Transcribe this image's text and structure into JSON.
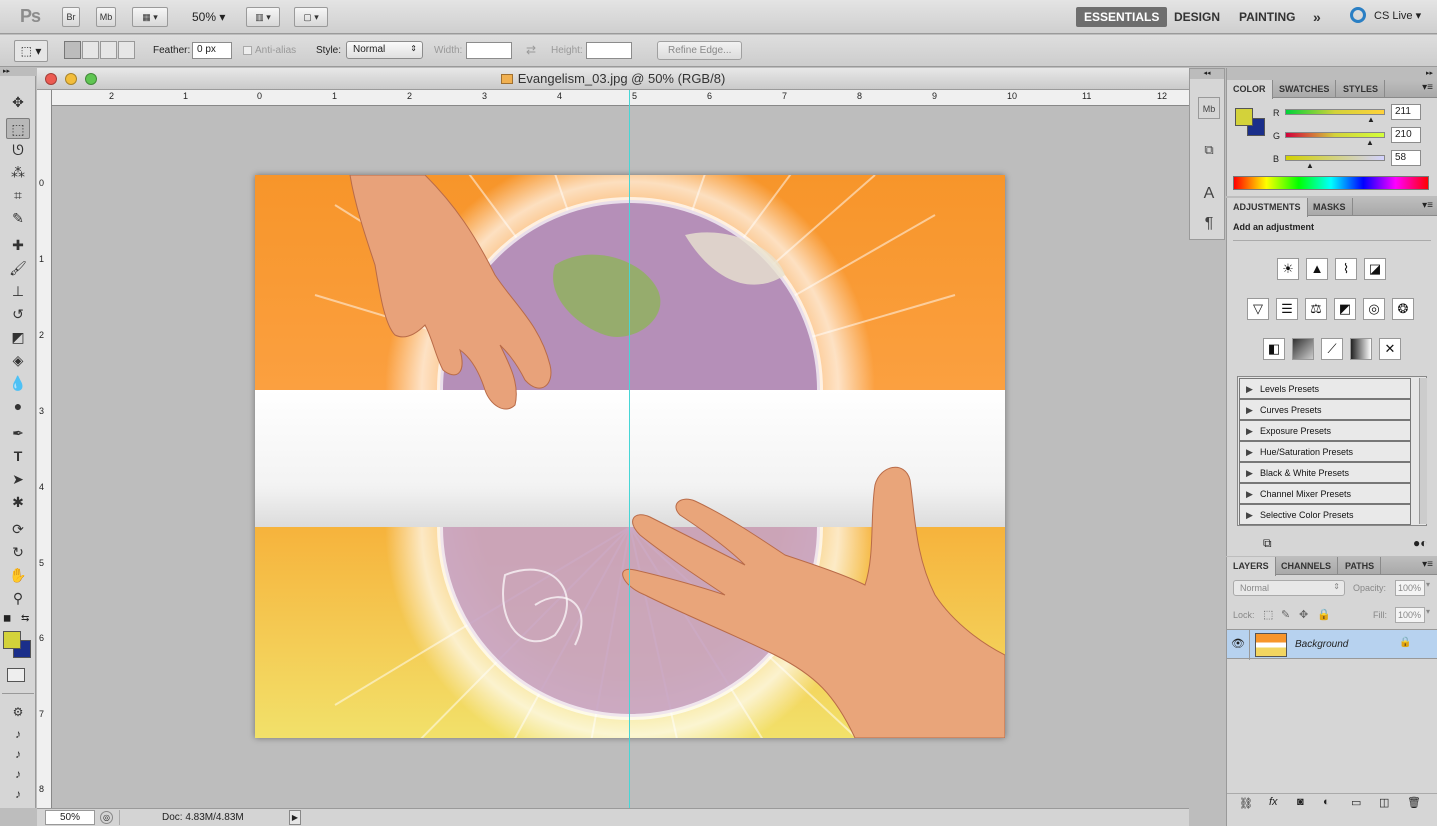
{
  "app": {
    "logo": "Ps",
    "bridge_btn": "Br",
    "minibridge_btn": "Mb",
    "zoom": "50%",
    "workspaces": [
      "ESSENTIALS",
      "DESIGN",
      "PAINTING"
    ],
    "more": "»",
    "cs_live": "CS Live"
  },
  "options": {
    "feather_label": "Feather:",
    "feather_value": "0 px",
    "antialias_label": "Anti-alias",
    "style_label": "Style:",
    "style_value": "Normal",
    "width_label": "Width:",
    "height_label": "Height:",
    "refine_edge": "Refine Edge..."
  },
  "document": {
    "title": "Evangelism_03.jpg @ 50% (RGB/8)",
    "ruler_h": [
      "2",
      "1",
      "0",
      "1",
      "2",
      "3",
      "4",
      "5",
      "6",
      "7",
      "8",
      "9",
      "10",
      "11",
      "12"
    ],
    "ruler_v": [
      "0",
      "1",
      "2",
      "3",
      "4",
      "5",
      "6",
      "7",
      "8"
    ],
    "status_zoom": "50%",
    "doc_size": "Doc: 4.83M/4.83M"
  },
  "color_panel": {
    "tabs": [
      "COLOR",
      "SWATCHES",
      "STYLES"
    ],
    "r_label": "R",
    "r_value": "211",
    "g_label": "G",
    "g_value": "210",
    "b_label": "B",
    "b_value": "58",
    "fg_color": "#d3d23a",
    "bg_color": "#1a2e8a"
  },
  "adjustments_panel": {
    "tabs": [
      "ADJUSTMENTS",
      "MASKS"
    ],
    "heading": "Add an adjustment",
    "presets": [
      "Levels Presets",
      "Curves Presets",
      "Exposure Presets",
      "Hue/Saturation Presets",
      "Black & White Presets",
      "Channel Mixer Presets",
      "Selective Color Presets"
    ]
  },
  "layers_panel": {
    "tabs": [
      "LAYERS",
      "CHANNELS",
      "PATHS"
    ],
    "blend_mode": "Normal",
    "opacity_label": "Opacity:",
    "opacity_value": "100%",
    "lock_label": "Lock:",
    "fill_label": "Fill:",
    "fill_value": "100%",
    "layer_name": "Background"
  }
}
